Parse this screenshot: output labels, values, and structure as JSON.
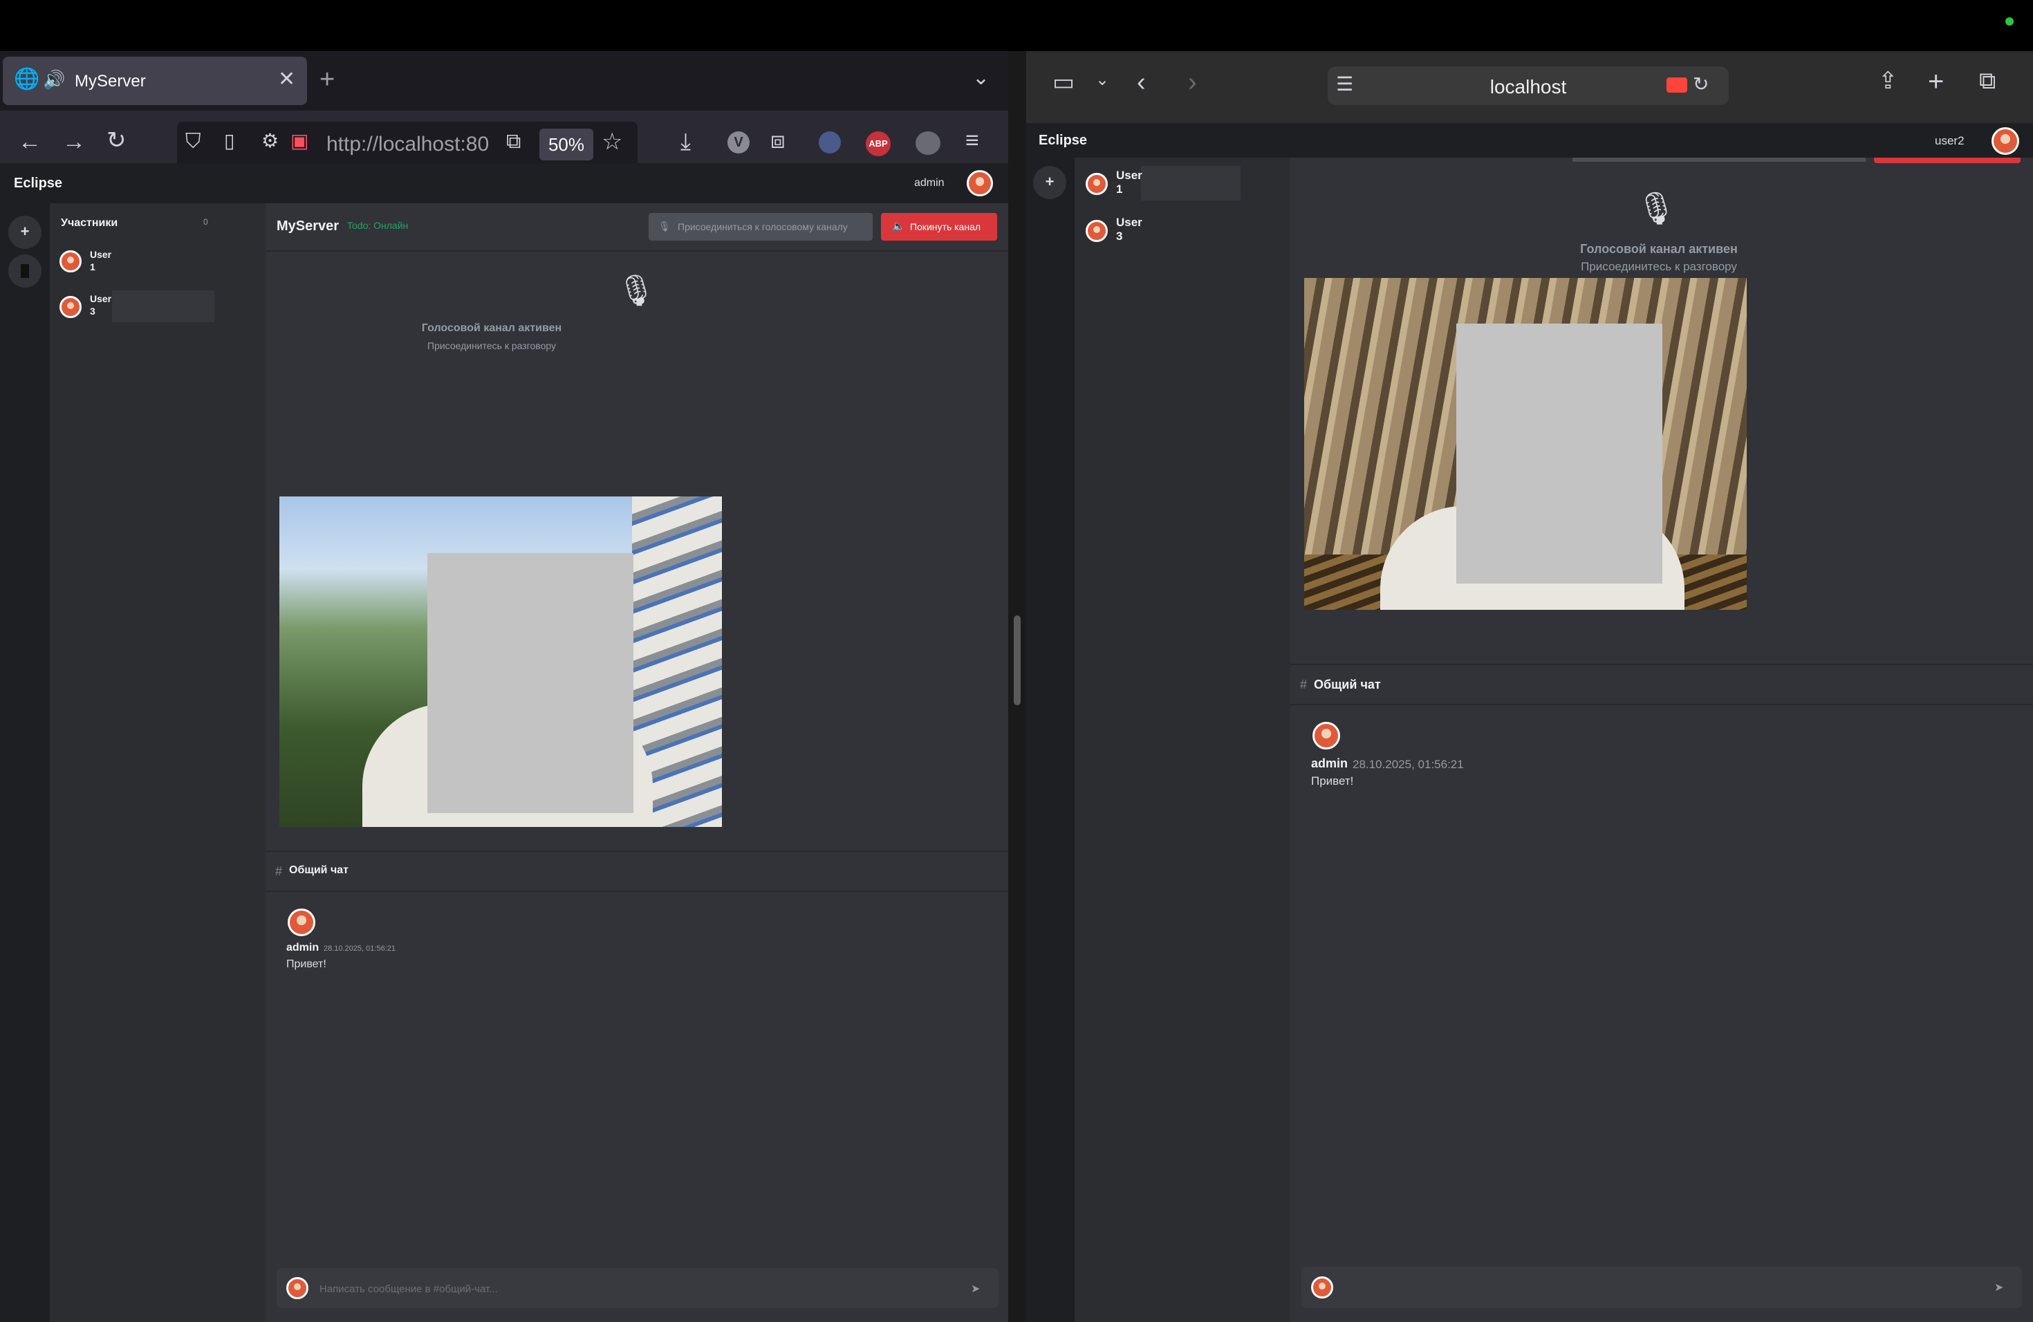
{
  "left_browser": {
    "tab": {
      "title": "MyServer",
      "icon": "globe-icon",
      "sound_icon": "speaker-icon"
    },
    "url": "http://localhost:80",
    "zoom": "50%",
    "toolbar_icons": [
      "back-icon",
      "forward-icon",
      "reload-icon",
      "shield-icon",
      "page-icon",
      "permissions-icon",
      "camera-icon",
      "reader-icon",
      "star-icon",
      "download-icon",
      "v-extension-icon",
      "extensions-icon",
      "circle-extension-icon",
      "abp-icon",
      "ghost-icon",
      "menu-icon"
    ],
    "abp_label": "ABP",
    "v_label": "V"
  },
  "right_browser": {
    "url": "localhost"
  },
  "app_left": {
    "brand": "Eclipse",
    "username": "admin",
    "rail": {
      "add_label": "+"
    },
    "members": {
      "header": "Участники",
      "count": "0",
      "items": [
        {
          "name_line1": "User",
          "name_line2": "1"
        },
        {
          "name_line1": "User",
          "name_line2": "3"
        }
      ]
    },
    "server": {
      "name": "MyServer",
      "status": "Todo: Онлайн",
      "join_voice": "Присоединиться к голосовому каналу",
      "leave_channel": "Покинуть канал"
    },
    "voice": {
      "title": "Голосовой канал активен",
      "subtitle": "Присоединитесь к разговору"
    },
    "chat": {
      "hash": "#",
      "channel": "Общий чат",
      "messages": [
        {
          "author": "admin",
          "time": "28.10.2025, 01:56:21",
          "text": "Привет!"
        }
      ],
      "input_placeholder": "Написать сообщение в #общий-чат...",
      "send": "➤"
    }
  },
  "app_right": {
    "brand": "Eclipse",
    "username": "user2",
    "rail": {
      "add_label": "+"
    },
    "members": {
      "items": [
        {
          "name_line1": "User",
          "name_line2": "1"
        },
        {
          "name_line1": "User",
          "name_line2": "3"
        }
      ]
    },
    "voice": {
      "title": "Голосовой канал активен",
      "subtitle": "Присоединитесь к разговору"
    },
    "chat": {
      "hash": "#",
      "channel": "Общий чат",
      "messages": [
        {
          "author": "admin",
          "time": "28.10.2025, 01:56:21",
          "text": "Привет!"
        }
      ],
      "send": "➤"
    }
  },
  "colors": {
    "accent_red": "#da373c",
    "online_green": "#23a55a",
    "avatar": "#e05a3a"
  }
}
